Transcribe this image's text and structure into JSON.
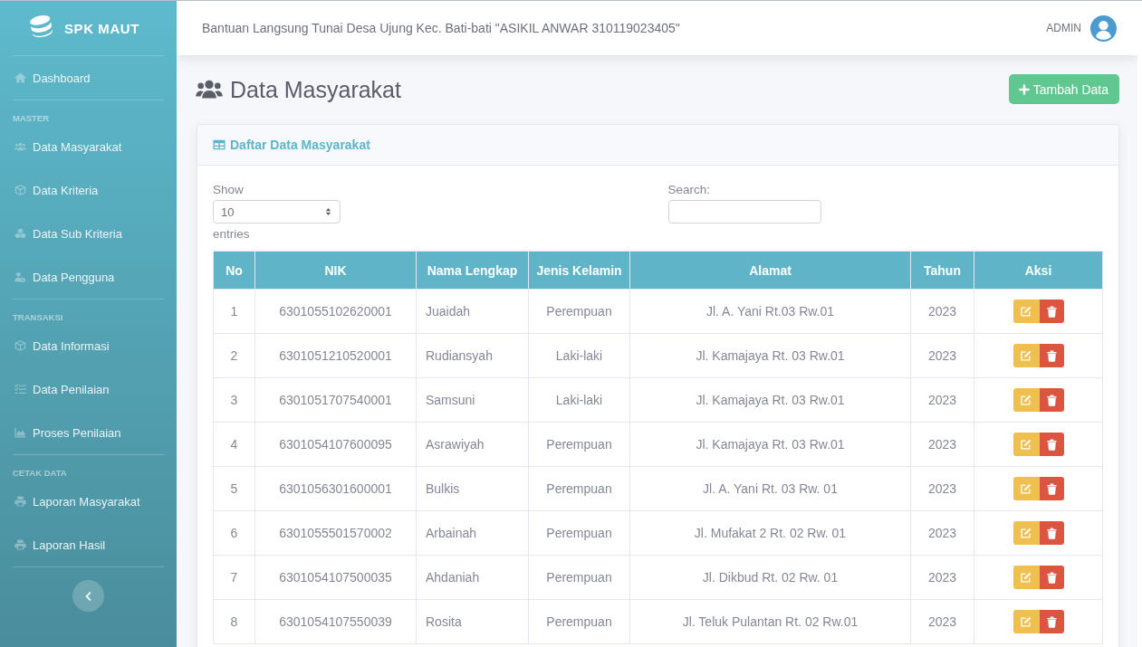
{
  "sidebar": {
    "brand": "SPK MAUT",
    "sections": [
      {
        "items": [
          {
            "label": "Dashboard",
            "selected": false
          }
        ]
      },
      {
        "heading": "MASTER",
        "items": [
          {
            "label": "Data Masyarakat",
            "selected": false
          },
          {
            "label": "Data Kriteria",
            "selected": false
          },
          {
            "label": "Data Sub Kriteria",
            "selected": false
          },
          {
            "label": "Data Pengguna",
            "selected": false
          }
        ]
      },
      {
        "heading": "TRANSAKSI",
        "items": [
          {
            "label": "Data Informasi",
            "selected": false
          },
          {
            "label": "Data Penilaian",
            "selected": false
          },
          {
            "label": "Proses Penilaian",
            "selected": false
          }
        ]
      },
      {
        "heading": "CETAK DATA",
        "items": [
          {
            "label": "Laporan Masyarakat",
            "selected": false
          },
          {
            "label": "Laporan Hasil",
            "selected": false
          }
        ]
      }
    ]
  },
  "topbar": {
    "title": "Bantuan Langsung Tunai Desa Ujung Kec. Bati-bati \"ASIKIL ANWAR 310119023405\"",
    "user": "ADMIN"
  },
  "page": {
    "title": "Data Masyarakat",
    "add_button": "Tambah Data"
  },
  "card": {
    "title": "Daftar Data Masyarakat",
    "length_control": {
      "label_before": "Show",
      "value": "10",
      "label_after": "entries"
    },
    "search": {
      "label": "Search:"
    },
    "table": {
      "columns": [
        "No",
        "NIK",
        "Nama Lengkap",
        "Jenis Kelamin",
        "Alamat",
        "Tahun",
        "Aksi"
      ],
      "rows": [
        [
          "1",
          "6301055102620001",
          "Juaidah",
          "Perempuan",
          "Jl. A. Yani Rt.03 Rw.01",
          "2023"
        ],
        [
          "2",
          "6301051210520001",
          "Rudiansyah",
          "Laki-laki",
          "Jl. Kamajaya Rt. 03 Rw.01",
          "2023"
        ],
        [
          "3",
          "6301051707540001",
          "Samsuni",
          "Laki-laki",
          "Jl. Kamajaya Rt. 03 Rw.01",
          "2023"
        ],
        [
          "4",
          "6301054107600095",
          "Asrawiyah",
          "Perempuan",
          "Jl. Kamajaya Rt. 03 Rw.01",
          "2023"
        ],
        [
          "5",
          "6301056301600001",
          "Bulkis",
          "Perempuan",
          "Jl. A. Yani Rt. 03 Rw. 01",
          "2023"
        ],
        [
          "6",
          "6301055501570002",
          "Arbainah",
          "Perempuan",
          "Jl. Mufakat 2 Rt. 02 Rw. 01",
          "2023"
        ],
        [
          "7",
          "6301054107500035",
          "Ahdaniah",
          "Perempuan",
          "Jl. Dikbud Rt. 02 Rw. 01",
          "2023"
        ],
        [
          "8",
          "6301054107550039",
          "Rosita",
          "Perempuan",
          "Jl. Teluk Pulantan Rt. 02 Rw.01",
          "2023"
        ]
      ]
    }
  }
}
